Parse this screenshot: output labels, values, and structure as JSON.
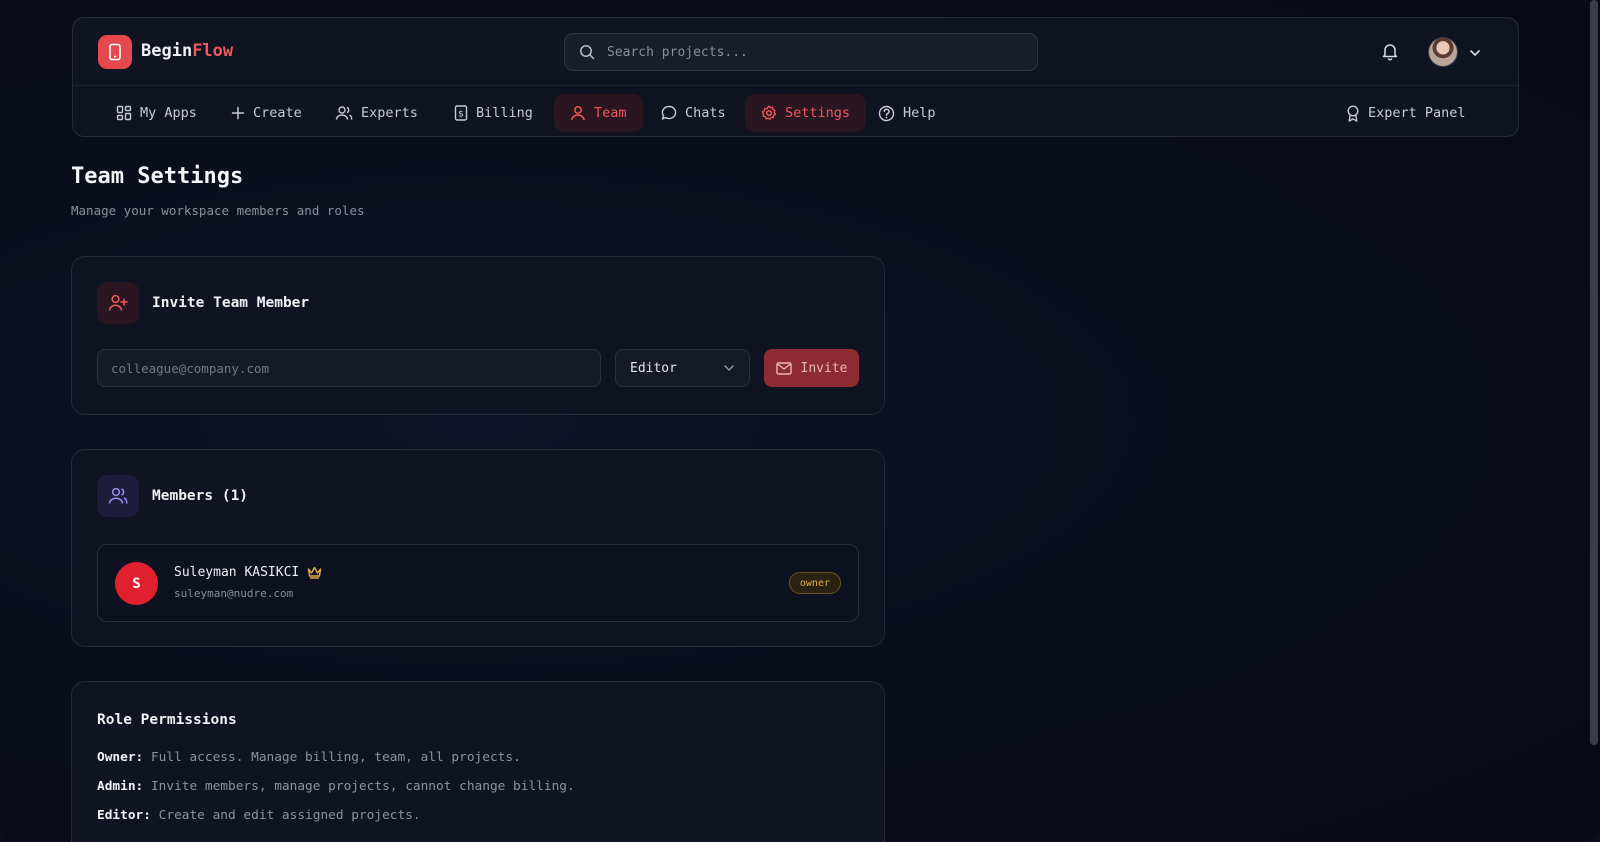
{
  "brand": {
    "name_part1": "Begin",
    "name_part2": "Flow",
    "accent_color": "#f0585d"
  },
  "search": {
    "placeholder": "Search projects..."
  },
  "header": {
    "bell_icon": "bell-icon",
    "avatar": "user-avatar",
    "menu_icon": "chevron-down-icon"
  },
  "nav": {
    "items": [
      {
        "label": "My Apps",
        "icon": "grid-icon"
      },
      {
        "label": "Create",
        "icon": "plus-icon"
      },
      {
        "label": "Experts",
        "icon": "users-icon"
      },
      {
        "label": "Billing",
        "icon": "receipt-icon"
      },
      {
        "label": "Team",
        "icon": "user-icon",
        "active": true
      },
      {
        "label": "Chats",
        "icon": "chat-icon"
      },
      {
        "label": "Settings",
        "icon": "gear-icon",
        "active": true
      },
      {
        "label": "Help",
        "icon": "help-icon"
      }
    ],
    "expert_panel": {
      "label": "Expert Panel",
      "icon": "award-icon"
    }
  },
  "page": {
    "title": "Team Settings",
    "subtitle": "Manage your workspace members and roles"
  },
  "invite": {
    "title": "Invite Team Member",
    "email_placeholder": "colleague@company.com",
    "email_value": "",
    "role_selected": "Editor",
    "button_label": "Invite"
  },
  "members": {
    "title": "Members (1)",
    "list": [
      {
        "initial": "S",
        "name": "Suleyman KASIKCI",
        "email": "suleyman@nudre.com",
        "role": "owner",
        "icon": "crown-icon"
      }
    ]
  },
  "permissions": {
    "title": "Role Permissions",
    "lines": [
      {
        "role": "Owner:",
        "desc": "Full access. Manage billing, team, all projects."
      },
      {
        "role": "Admin:",
        "desc": "Invite members, manage projects, cannot change billing."
      },
      {
        "role": "Editor:",
        "desc": "Create and edit assigned projects."
      }
    ]
  },
  "colors": {
    "background": "#0b0e1c",
    "card": "#0f1322",
    "accent": "#e5484d",
    "owner_badge": "#e0b045"
  }
}
